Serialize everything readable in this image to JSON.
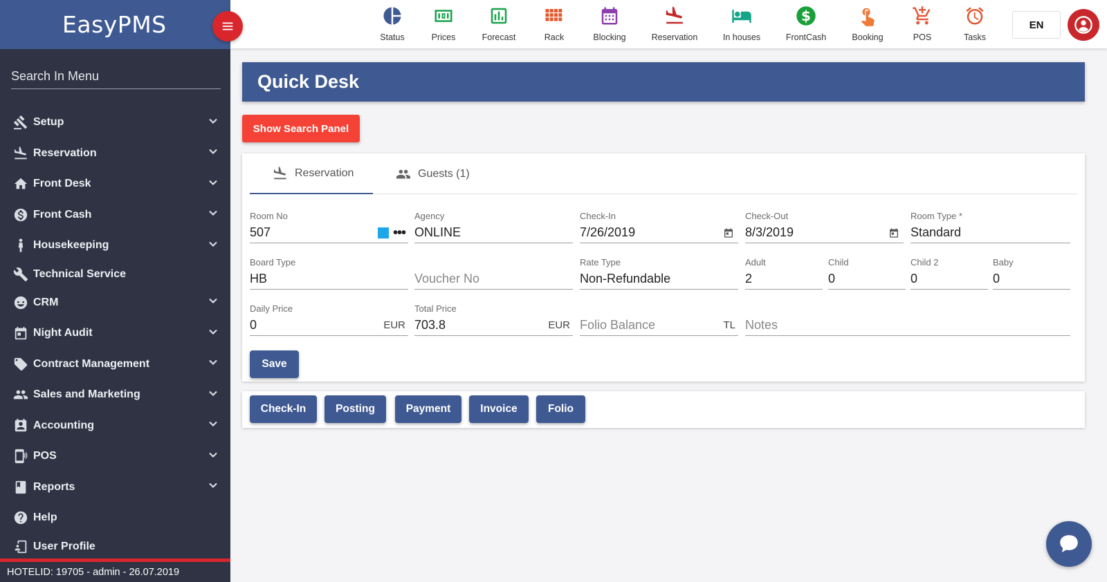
{
  "app": {
    "name": "EasyPMS"
  },
  "sidebar": {
    "search_placeholder": "Search In Menu",
    "items": [
      {
        "label": "Setup",
        "icon": "gavel-icon",
        "expandable": true
      },
      {
        "label": "Reservation",
        "icon": "plane-landing-icon",
        "expandable": true
      },
      {
        "label": "Front Desk",
        "icon": "home-icon",
        "expandable": true
      },
      {
        "label": "Front Cash",
        "icon": "dollar-circle-icon",
        "expandable": true
      },
      {
        "label": "Housekeeping",
        "icon": "person-icon",
        "expandable": true
      },
      {
        "label": "Technical Service",
        "icon": "wrench-icon",
        "expandable": false
      },
      {
        "label": "CRM",
        "icon": "face-icon",
        "expandable": true
      },
      {
        "label": "Night Audit",
        "icon": "calendar-icon",
        "expandable": true
      },
      {
        "label": "Contract Management",
        "icon": "tag-icon",
        "expandable": true
      },
      {
        "label": "Sales and Marketing",
        "icon": "people-icon",
        "expandable": true
      },
      {
        "label": "Accounting",
        "icon": "contact-card-icon",
        "expandable": true
      },
      {
        "label": "POS",
        "icon": "mobile-pos-icon",
        "expandable": true
      },
      {
        "label": "Reports",
        "icon": "book-icon",
        "expandable": true
      },
      {
        "label": "Help",
        "icon": "help-circle-icon",
        "expandable": false
      },
      {
        "label": "User Profile",
        "icon": "user-profile-icon",
        "expandable": false
      }
    ],
    "status": "HOTELID: 19705 - admin - 26.07.2019"
  },
  "toolbar": {
    "items": [
      {
        "label": "Status",
        "icon": "pie-chart-icon",
        "color": "#3f5a92"
      },
      {
        "label": "Prices",
        "icon": "money-icon",
        "color": "#17a34a"
      },
      {
        "label": "Forecast",
        "icon": "bar-chart-icon",
        "color": "#17a34a"
      },
      {
        "label": "Rack",
        "icon": "grid-icon",
        "color": "#e2572b"
      },
      {
        "label": "Blocking",
        "icon": "calendar-block-icon",
        "color": "#8e3fae"
      },
      {
        "label": "Reservation",
        "icon": "plane-landing-icon",
        "color": "#c62828"
      },
      {
        "label": "In houses",
        "icon": "bed-icon",
        "color": "#17a589"
      },
      {
        "label": "FrontCash",
        "icon": "dollar-circle-icon",
        "color": "#1aa03a"
      },
      {
        "label": "Booking",
        "icon": "touch-icon",
        "color": "#ef7a3a"
      },
      {
        "label": "POS",
        "icon": "cart-icon",
        "color": "#e25a3a"
      },
      {
        "label": "Tasks",
        "icon": "alarm-icon",
        "color": "#e0552c"
      }
    ],
    "language": "EN"
  },
  "page": {
    "title": "Quick Desk",
    "show_search_label": "Show Search Panel"
  },
  "tabs": [
    {
      "label": "Reservation",
      "active": true
    },
    {
      "label": "Guests (1)",
      "active": false
    }
  ],
  "form": {
    "room_no": {
      "label": "Room No",
      "value": "507"
    },
    "agency": {
      "label": "Agency",
      "value": "ONLINE"
    },
    "check_in": {
      "label": "Check-In",
      "value": "7/26/2019"
    },
    "check_out": {
      "label": "Check-Out",
      "value": "8/3/2019"
    },
    "room_type": {
      "label": "Room Type *",
      "value": "Standard"
    },
    "board_type": {
      "label": "Board Type",
      "value": "HB"
    },
    "voucher_no": {
      "label": "",
      "placeholder": "Voucher No"
    },
    "rate_type": {
      "label": "Rate Type",
      "value": "Non-Refundable"
    },
    "adult": {
      "label": "Adult",
      "value": "2"
    },
    "child": {
      "label": "Child",
      "value": "0"
    },
    "child2": {
      "label": "Child 2",
      "value": "0"
    },
    "baby": {
      "label": "Baby",
      "value": "0"
    },
    "daily_price": {
      "label": "Daily Price",
      "value": "0",
      "currency": "EUR"
    },
    "total_price": {
      "label": "Total Price",
      "value": "703.8",
      "currency": "EUR"
    },
    "folio_balance": {
      "placeholder": "Folio Balance",
      "currency": "TL"
    },
    "notes": {
      "placeholder": "Notes"
    },
    "save_label": "Save"
  },
  "actions": [
    "Check-In",
    "Posting",
    "Payment",
    "Invoice",
    "Folio"
  ],
  "colors": {
    "primary": "#3f5a92",
    "danger": "#f44336",
    "sidebar": "#2f3343",
    "room_color": "#1ea7e8"
  }
}
